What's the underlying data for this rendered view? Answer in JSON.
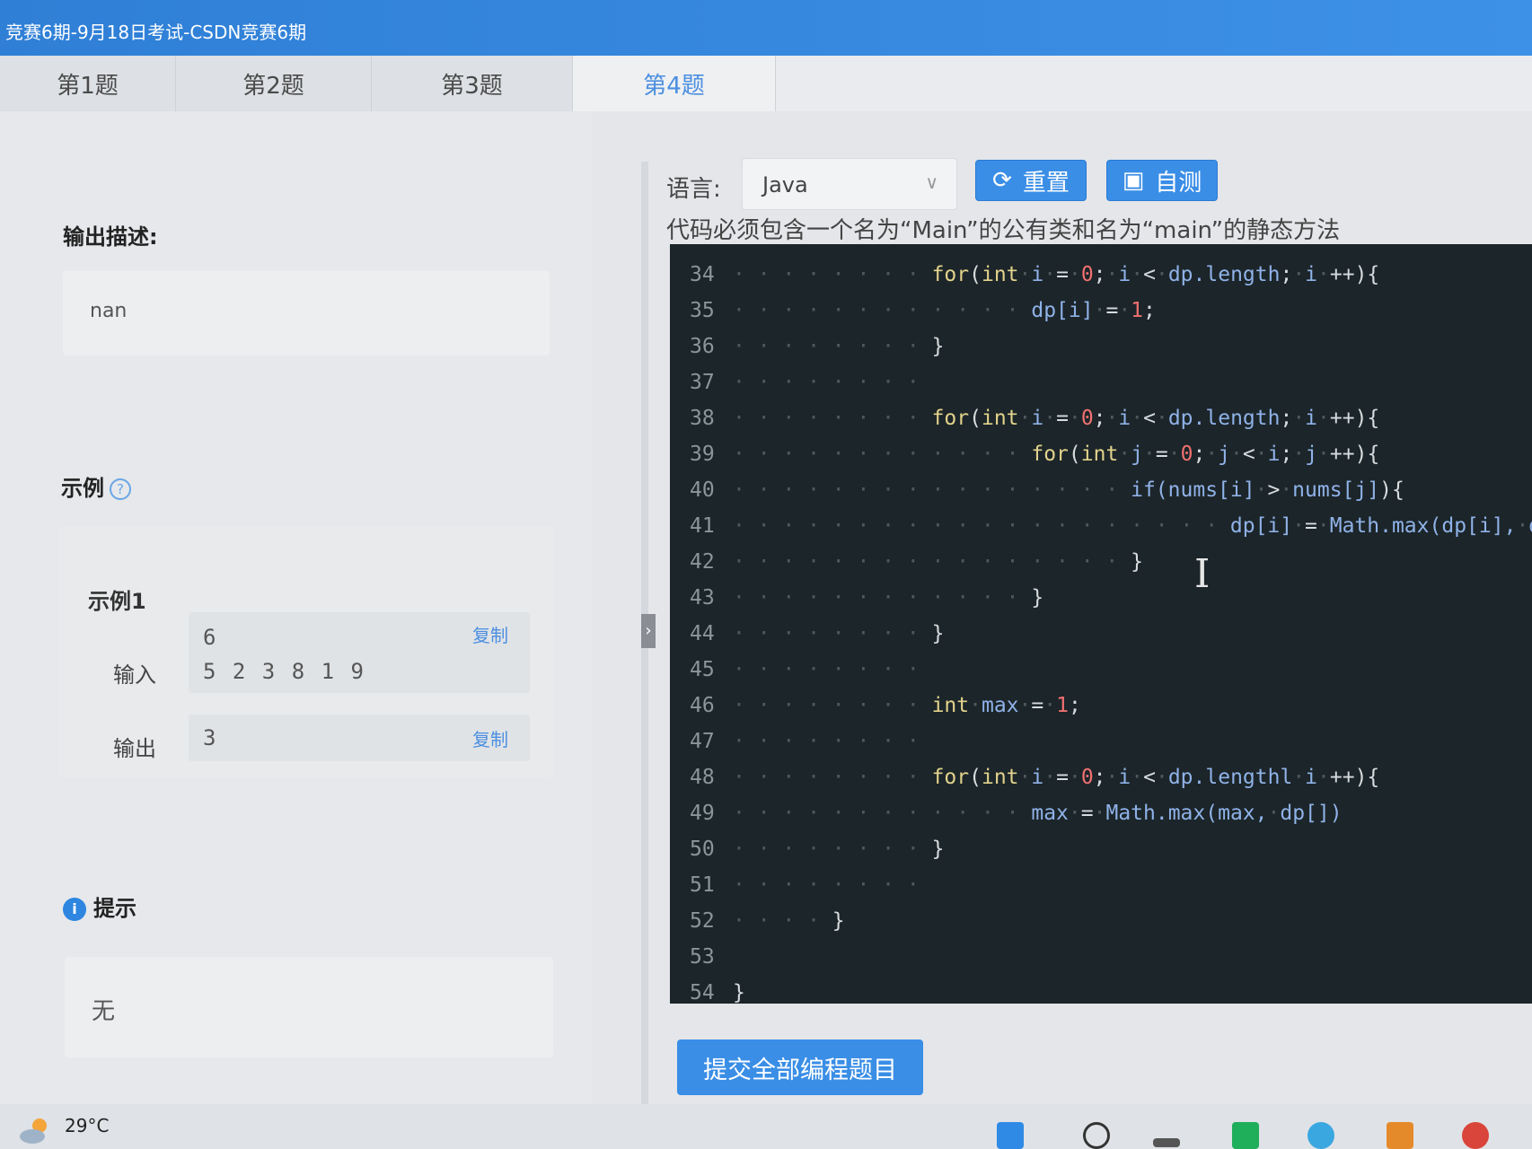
{
  "window": {
    "title": "竞赛6期-9月18日考试-CSDN竞赛6期"
  },
  "tabs": [
    {
      "label": "第1题"
    },
    {
      "label": "第2题"
    },
    {
      "label": "第3题"
    },
    {
      "label": "第4题",
      "active": true
    }
  ],
  "left": {
    "output_desc_title": "输出描述:",
    "output_desc_value": "nan",
    "example_title": "示例",
    "example1_title": "示例1",
    "input_label": "输入",
    "input_line1": "6",
    "input_line2": "5 2 3 8 1 9",
    "output_label": "输出",
    "output_value": "3",
    "copy_label": "复制",
    "hint_title": "提示",
    "hint_value": "无"
  },
  "toolbar": {
    "lang_label": "语言:",
    "lang_value": "Java",
    "reset_label": "重置",
    "selftest_label": "自测",
    "requirement": "代码必须包含一个名为“Main”的公有类和名为“main”的静态方法"
  },
  "editor": {
    "line_numbers": [
      "34",
      "35",
      "36",
      "37",
      "38",
      "39",
      "40",
      "41",
      "42",
      "43",
      "44",
      "45",
      "46",
      "47",
      "48",
      "49",
      "50",
      "51",
      "52",
      "53",
      "54"
    ]
  },
  "submit": {
    "label": "提交全部编程题目"
  },
  "taskbar": {
    "temperature": "29°C"
  },
  "colors": {
    "accent": "#3a8ee6",
    "editor_bg": "#1c2529",
    "keyword": "#e2d38c",
    "number": "#f07070",
    "identifier": "#8fb2e8"
  }
}
